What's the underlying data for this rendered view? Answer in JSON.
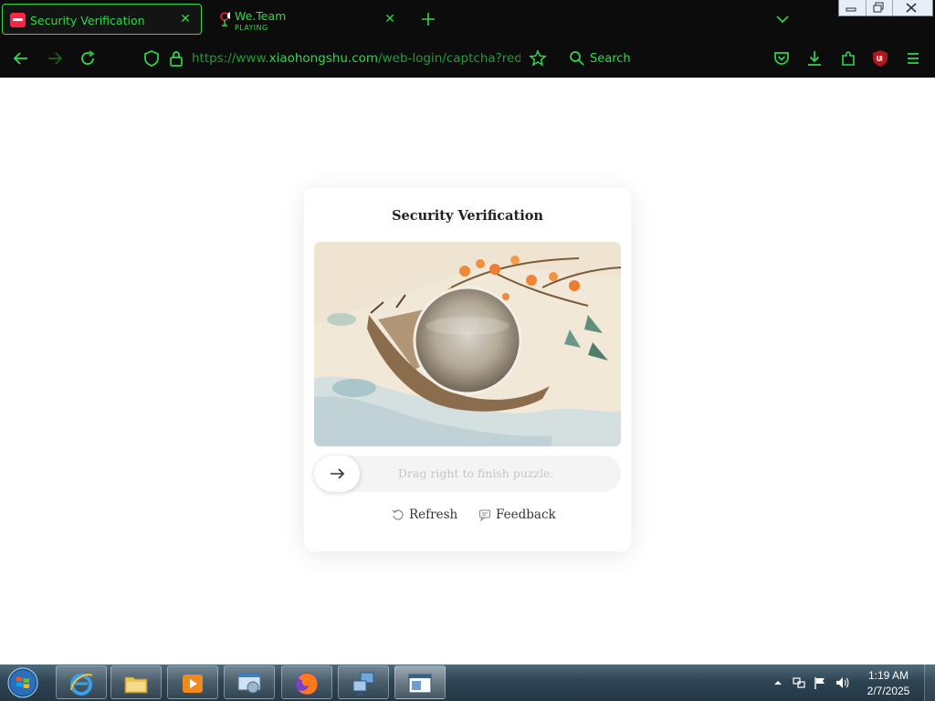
{
  "browser": {
    "tabs": [
      {
        "label": "Security Verification",
        "active": true,
        "favicon": "xiaohongshu-logo-icon"
      },
      {
        "label": "We.Team",
        "status": "PLAYING",
        "active": false,
        "favicon": "audio-playing-icon"
      }
    ],
    "new_tab_icon": "plus-icon",
    "tab_list_icon": "chevron-down-icon",
    "url": {
      "prefix": "https://www.",
      "host": "xiaohongshu.com",
      "path": "/web-login/captcha?redirectP"
    },
    "search_label": "Search",
    "accent_color": "#2fd84a"
  },
  "captcha": {
    "title": "Security Verification",
    "slider_hint": "Drag right to finish puzzle.",
    "refresh_label": "Refresh",
    "feedback_label": "Feedback"
  },
  "taskbar": {
    "clock_time": "1:19 AM",
    "clock_date": "2/7/2025",
    "pinned": [
      "internet-explorer-icon",
      "file-explorer-icon",
      "media-player-icon",
      "control-panel-icon",
      "firefox-icon",
      "network-computer-icon",
      "window-app-icon"
    ]
  }
}
